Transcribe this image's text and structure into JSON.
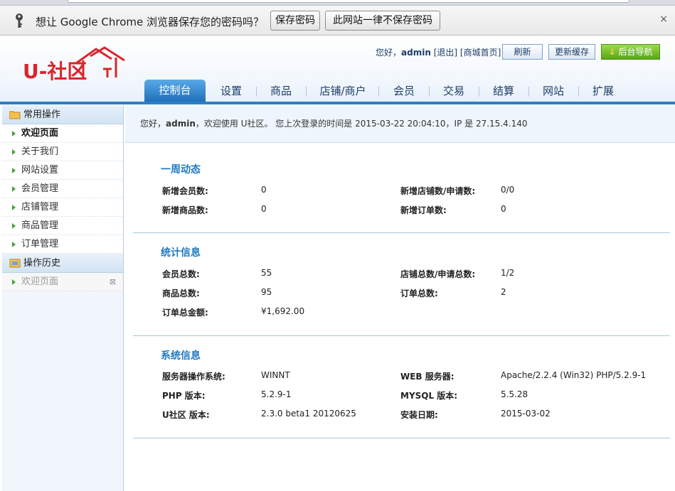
{
  "infobar": {
    "message": "想让 Google Chrome 浏览器保存您的密码吗？",
    "save_label": "保存密码",
    "never_label": "此网站一律不保存密码",
    "close": "×"
  },
  "header": {
    "logo_text": "U-社区",
    "greeting": "您好，",
    "username": "admin",
    "logout": "[退出]",
    "mall_home": "[商城首页]",
    "refresh": "刷新",
    "update_cache": "更新缓存",
    "backend_nav": "后台导航"
  },
  "nav": {
    "tabs": [
      "控制台",
      "设置",
      "商品",
      "店铺/商户",
      "会员",
      "交易",
      "结算",
      "网站",
      "扩展"
    ],
    "active": "控制台"
  },
  "sidebar": {
    "common_title": "常用操作",
    "items": [
      "欢迎页面",
      "关于我们",
      "网站设置",
      "会员管理",
      "店铺管理",
      "商品管理",
      "订单管理"
    ],
    "history_title": "操作历史",
    "history_items": [
      "欢迎页面"
    ],
    "history_close": "⊠"
  },
  "welcome": {
    "text_prefix": "您好，",
    "username": "admin",
    "text_suffix": "，欢迎使用 U社区。 您上次登录的时间是 2015-03-22 20:04:10，IP 是 27.15.4.140"
  },
  "weekly": {
    "title": "一周动态",
    "new_members_label": "新增会员数:",
    "new_members": "0",
    "new_stores_label": "新增店铺数/申请数:",
    "new_stores": "0/0",
    "new_goods_label": "新增商品数:",
    "new_goods": "0",
    "new_orders_label": "新增订单数:",
    "new_orders": "0"
  },
  "stats": {
    "title": "统计信息",
    "members_label": "会员总数:",
    "members": "55",
    "stores_label": "店铺总数/申请总数:",
    "stores": "1/2",
    "goods_label": "商品总数:",
    "goods": "95",
    "orders_label": "订单总数:",
    "orders": "2",
    "amount_label": "订单总金额:",
    "amount": "¥1,692.00"
  },
  "sysinfo": {
    "title": "系统信息",
    "os_label": "服务器操作系统:",
    "os": "WINNT",
    "web_label": "WEB 服务器:",
    "web": "Apache/2.2.4 (Win32) PHP/5.2.9-1",
    "php_label": "PHP 版本:",
    "php": "5.2.9-1",
    "mysql_label": "MYSQL 版本:",
    "mysql": "5.5.28",
    "ver_label": "U社区 版本:",
    "ver": "2.3.0 beta1 20120625",
    "install_label": "安装日期:",
    "install": "2015-03-02"
  },
  "colors": {
    "accent": "#1f7ac0",
    "logo_red": "#d9262c",
    "green_button": "#58a616"
  }
}
